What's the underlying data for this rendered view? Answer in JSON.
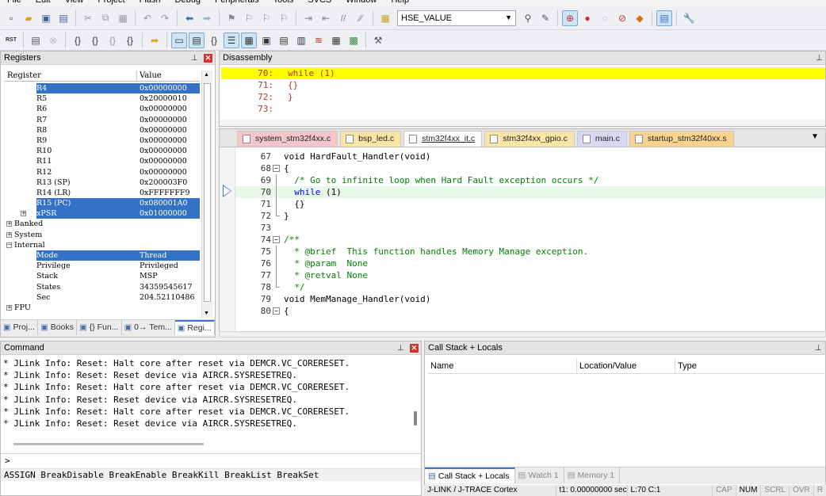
{
  "menu": [
    "File",
    "Edit",
    "View",
    "Project",
    "Flash",
    "Debug",
    "Peripherals",
    "Tools",
    "SVCS",
    "Window",
    "Help"
  ],
  "toolbar": {
    "find_value": "HSE_VALUE"
  },
  "registers": {
    "title": "Registers",
    "columns": [
      "Register",
      "Value"
    ],
    "rows": [
      {
        "name": "R4",
        "value": "0x00000000",
        "indent": 3,
        "selected": true
      },
      {
        "name": "R5",
        "value": "0x20000010",
        "indent": 3
      },
      {
        "name": "R6",
        "value": "0x00000000",
        "indent": 3
      },
      {
        "name": "R7",
        "value": "0x00000000",
        "indent": 3
      },
      {
        "name": "R8",
        "value": "0x00000000",
        "indent": 3
      },
      {
        "name": "R9",
        "value": "0x00000000",
        "indent": 3
      },
      {
        "name": "R10",
        "value": "0x00000000",
        "indent": 3
      },
      {
        "name": "R11",
        "value": "0x00000000",
        "indent": 3
      },
      {
        "name": "R12",
        "value": "0x00000000",
        "indent": 3
      },
      {
        "name": "R13 (SP)",
        "value": "0x200003F0",
        "indent": 3
      },
      {
        "name": "R14 (LR)",
        "value": "0xFFFFFFF9",
        "indent": 3
      },
      {
        "name": "R15 (PC)",
        "value": "0x080001A0",
        "indent": 3,
        "selected": true
      },
      {
        "name": "xPSR",
        "value": "0x01000000",
        "indent": 3,
        "selected": true,
        "expander": "+"
      },
      {
        "name": "Banked",
        "value": "",
        "indent": 1,
        "expander": "+"
      },
      {
        "name": "System",
        "value": "",
        "indent": 1,
        "expander": "+"
      },
      {
        "name": "Internal",
        "value": "",
        "indent": 1,
        "expander": "-"
      },
      {
        "name": "Mode",
        "value": "Thread",
        "indent": 3,
        "selected": true
      },
      {
        "name": "Privilege",
        "value": "Privileged",
        "indent": 3
      },
      {
        "name": "Stack",
        "value": "MSP",
        "indent": 3
      },
      {
        "name": "States",
        "value": "34359545617",
        "indent": 3
      },
      {
        "name": "Sec",
        "value": "204.52110486",
        "indent": 3
      },
      {
        "name": "FPU",
        "value": "",
        "indent": 1,
        "expander": "+"
      }
    ],
    "bottom_tabs": [
      {
        "label": "Proj...",
        "icon": "project-icon"
      },
      {
        "label": "Books",
        "icon": "books-icon"
      },
      {
        "label": "{} Fun...",
        "icon": "functions-icon"
      },
      {
        "label": "0→ Tem...",
        "icon": "templates-icon"
      },
      {
        "label": "Regi...",
        "icon": "registers-icon",
        "active": true
      }
    ]
  },
  "disassembly": {
    "title": "Disassembly",
    "lines": [
      {
        "num": "70:",
        "code": "while (1)",
        "highlight": true
      },
      {
        "num": "71:",
        "code": "{}"
      },
      {
        "num": "72:",
        "code": "}"
      },
      {
        "num": "73:",
        "code": ""
      }
    ]
  },
  "editor_tabs": [
    {
      "label": "system_stm32f4xx.c",
      "color": "pink"
    },
    {
      "label": "bsp_led.c",
      "color": "yellow"
    },
    {
      "label": "stm32f4xx_it.c",
      "color": "active",
      "active": true
    },
    {
      "label": "stm32f4xx_gpio.c",
      "color": "yellow"
    },
    {
      "label": "main.c",
      "color": "lav"
    },
    {
      "label": "startup_stm32f40xx.s",
      "color": "orange"
    }
  ],
  "editor": {
    "lines": [
      {
        "n": "67",
        "fold": "",
        "parts": [
          [
            "fn",
            "void HardFault_Handler(void)"
          ]
        ]
      },
      {
        "n": "68",
        "fold": "box-",
        "parts": [
          [
            "fn",
            "{"
          ]
        ]
      },
      {
        "n": "69",
        "fold": "line",
        "parts": [
          [
            "cm",
            "  /* Go to infinite loop when Hard Fault exception occurs */"
          ]
        ]
      },
      {
        "n": "70",
        "fold": "line",
        "parts": [
          [
            "kw",
            "  while"
          ],
          [
            "fn",
            " (1)"
          ]
        ],
        "current": true
      },
      {
        "n": "71",
        "fold": "line",
        "parts": [
          [
            "fn",
            "  {}"
          ]
        ]
      },
      {
        "n": "72",
        "fold": "end",
        "parts": [
          [
            "fn",
            "}"
          ]
        ]
      },
      {
        "n": "73",
        "fold": "",
        "parts": [
          [
            "fn",
            ""
          ]
        ]
      },
      {
        "n": "74",
        "fold": "box-",
        "parts": [
          [
            "cm",
            "/**"
          ]
        ]
      },
      {
        "n": "75",
        "fold": "line",
        "parts": [
          [
            "cm",
            "  * @brief  This function handles Memory Manage exception."
          ]
        ]
      },
      {
        "n": "76",
        "fold": "line",
        "parts": [
          [
            "cm",
            "  * @param  None"
          ]
        ]
      },
      {
        "n": "77",
        "fold": "line",
        "parts": [
          [
            "cm",
            "  * @retval None"
          ]
        ]
      },
      {
        "n": "78",
        "fold": "end",
        "parts": [
          [
            "cm",
            "  */"
          ]
        ]
      },
      {
        "n": "79",
        "fold": "",
        "parts": [
          [
            "fn",
            "void MemManage_Handler(void)"
          ]
        ]
      },
      {
        "n": "80",
        "fold": "box-",
        "parts": [
          [
            "fn",
            "{"
          ]
        ]
      }
    ]
  },
  "command": {
    "title": "Command",
    "lines": [
      "* JLink Info: Reset: Halt core after reset via DEMCR.VC_CORERESET.",
      "* JLink Info: Reset: Reset device via AIRCR.SYSRESETREQ.",
      "* JLink Info: Reset: Halt core after reset via DEMCR.VC_CORERESET.",
      "* JLink Info: Reset: Reset device via AIRCR.SYSRESETREQ.",
      "* JLink Info: Reset: Halt core after reset via DEMCR.VC_CORERESET.",
      "* JLink Info: Reset: Reset device via AIRCR.SYSRESETREQ."
    ],
    "prompt": ">",
    "hint": "ASSIGN BreakDisable BreakEnable BreakKill BreakList BreakSet"
  },
  "callstack": {
    "title": "Call Stack + Locals",
    "columns": [
      "Name",
      "Location/Value",
      "Type"
    ],
    "tabs": [
      {
        "label": "Call Stack + Locals",
        "active": true
      },
      {
        "label": "Watch 1"
      },
      {
        "label": "Memory 1"
      }
    ]
  },
  "status": {
    "debugger": "J-LINK / J-TRACE Cortex",
    "time": "t1: 0.00000000 sec",
    "position": "L:70 C:1",
    "caps": "CAP",
    "num": "NUM",
    "scrl": "SCRL",
    "ovr": "OVR",
    "rw": "R"
  }
}
